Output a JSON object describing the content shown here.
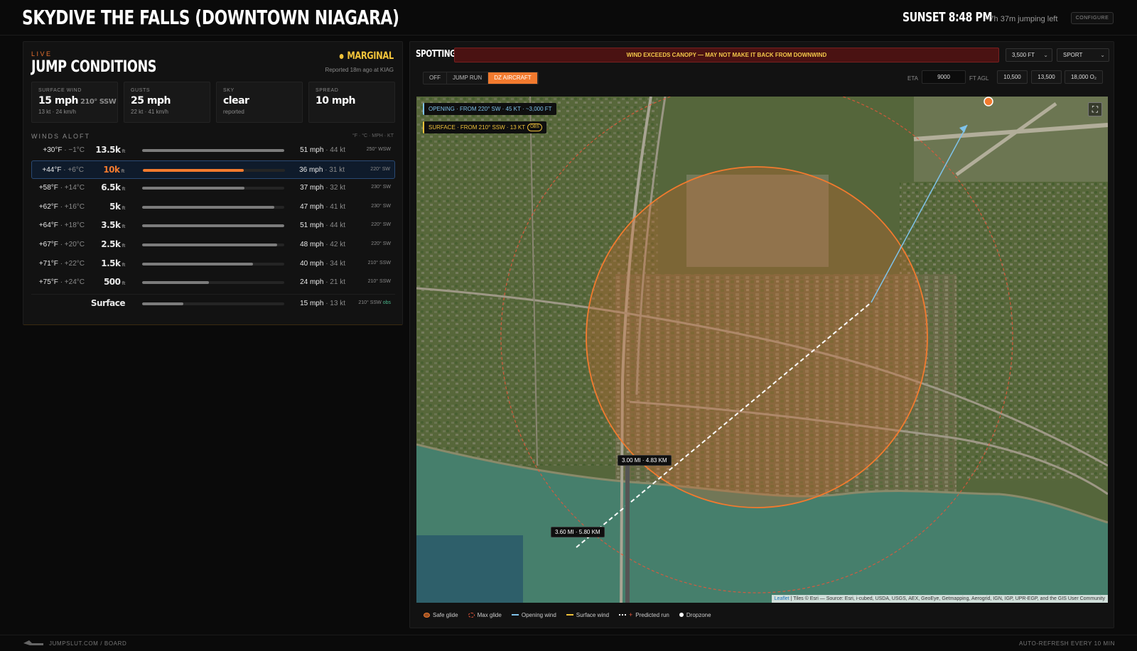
{
  "header": {
    "title": "SKYDIVE THE FALLS (DOWNTOWN NIAGARA)",
    "sunset": "SUNSET 8:48 PM",
    "jumping_left": "~7h 37m jumping left",
    "configure": "CONFIGURE"
  },
  "conditions": {
    "live": "LIVE",
    "title": "JUMP CONDITIONS",
    "status": "MARGINAL",
    "status_color": "#f0c23a",
    "reported": "Reported 18m ago at KIAG",
    "cards": [
      {
        "label": "SURFACE WIND",
        "value": "15 mph",
        "dir": "210° SSW",
        "sub": "13 kt · 24 km/h"
      },
      {
        "label": "GUSTS",
        "value": "25 mph",
        "dir": "",
        "sub": "22 kt · 41 km/h"
      },
      {
        "label": "SKY",
        "value": "clear",
        "dir": "",
        "sub": "reported"
      },
      {
        "label": "SPREAD",
        "value": "10 mph",
        "dir": "",
        "sub": ""
      }
    ]
  },
  "winds_aloft": {
    "title": "WINDS ALOFT",
    "units": "°F · °C · MPH · KT",
    "selected_index": 1,
    "rows": [
      {
        "tf": "+30°F",
        "tc": "· −1°C",
        "alt": "13.5k",
        "ft": "ft",
        "mph": "51 mph",
        "kt": "· 44 kt",
        "dir": "250° WSW",
        "level": 1.0
      },
      {
        "tf": "+44°F",
        "tc": "· +6°C",
        "alt": "10k",
        "ft": "ft",
        "mph": "36 mph",
        "kt": "· 31 kt",
        "dir": "220° SW",
        "level": 0.71
      },
      {
        "tf": "+58°F",
        "tc": "· +14°C",
        "alt": "6.5k",
        "ft": "ft",
        "mph": "37 mph",
        "kt": "· 32 kt",
        "dir": "230° SW",
        "level": 0.72
      },
      {
        "tf": "+62°F",
        "tc": "· +16°C",
        "alt": "5k",
        "ft": "ft",
        "mph": "47 mph",
        "kt": "· 41 kt",
        "dir": "230° SW",
        "level": 0.93
      },
      {
        "tf": "+64°F",
        "tc": "· +18°C",
        "alt": "3.5k",
        "ft": "ft",
        "mph": "51 mph",
        "kt": "· 44 kt",
        "dir": "220° SW",
        "level": 1.0
      },
      {
        "tf": "+67°F",
        "tc": "· +20°C",
        "alt": "2.5k",
        "ft": "ft",
        "mph": "48 mph",
        "kt": "· 42 kt",
        "dir": "220° SW",
        "level": 0.95
      },
      {
        "tf": "+71°F",
        "tc": "· +22°C",
        "alt": "1.5k",
        "ft": "ft",
        "mph": "40 mph",
        "kt": "· 34 kt",
        "dir": "210° SSW",
        "level": 0.78
      },
      {
        "tf": "+75°F",
        "tc": "· +24°C",
        "alt": "500",
        "ft": "ft",
        "mph": "24 mph",
        "kt": "· 21 kt",
        "dir": "210° SSW",
        "level": 0.47
      }
    ],
    "surface": {
      "alt": "Surface",
      "mph": "15 mph",
      "kt": "· 13 kt",
      "dir": "210° SSW",
      "obs": "obs",
      "level": 0.29
    }
  },
  "spotting": {
    "title": "SPOTTING",
    "warning": "WIND EXCEEDS CANOPY — MAY NOT MAKE IT BACK FROM DOWNWIND",
    "alt_select": "3,500 FT",
    "mode_select": "SPORT",
    "segments": [
      "OFF",
      "JUMP RUN",
      "DZ AIRCRAFT"
    ],
    "active_segment": 2,
    "eta_label": "ETA",
    "eta_value": "9000",
    "ftagl_label": "FT AGL",
    "altitudes": [
      "10,500",
      "13,500",
      "18,000 O₂"
    ]
  },
  "map": {
    "opening_chip": "OPENING · FROM 220° SW · 45 KT · ~3,000 FT",
    "surface_chip": "SURFACE · FROM 210° SSW · 13 KT",
    "obs_tag": "OBS",
    "dist1": "3.00 MI · 4.83 KM",
    "dist2": "3.60 MI · 5.80 KM",
    "attribution_leaflet": "Leaflet",
    "attribution_rest": " | Tiles © Esri — Source: Esri, i-cubed, USDA, USGS, AEX, GeoEye, Getmapping, Aerogrid, IGN, IGP, UPR-EGP, and the GIS User Community"
  },
  "legend": [
    "Safe glide",
    "Max glide",
    "Opening wind",
    "Surface wind",
    "Predicted run",
    "Dropzone"
  ],
  "colors": {
    "accent": "#f27a2e",
    "opening_wind": "#7fc3ea",
    "surface_wind": "#f0c23a",
    "marginal": "#f0c23a"
  },
  "footer": {
    "left": "JUMPSLUT.COM / BOARD",
    "right": "AUTO-REFRESH EVERY 10 MIN"
  }
}
